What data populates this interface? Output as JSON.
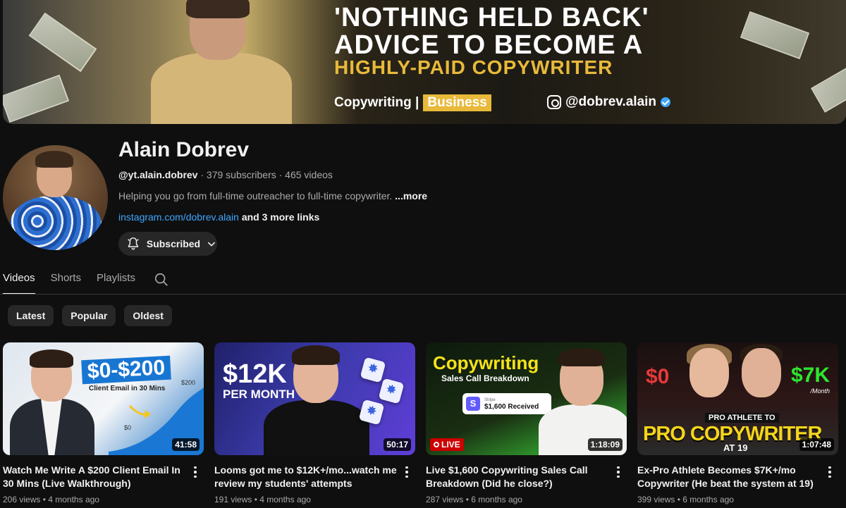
{
  "banner": {
    "line1": "'NOTHING HELD BACK'",
    "line2": "ADVICE TO BECOME A",
    "line3": "HIGHLY-PAID COPYWRITER",
    "tag_left": "Copywriting |",
    "tag_right": "Business",
    "instagram": "@dobrev.alain"
  },
  "channel": {
    "name": "Alain Dobrev",
    "handle": "@yt.alain.dobrev",
    "stats": "· 379 subscribers · 465 videos",
    "description": "Helping you go from full-time outreacher to full-time copywriter.",
    "more": "...more",
    "link": "instagram.com/dobrev.alain",
    "more_links": "and 3 more links",
    "subscribe_label": "Subscribed"
  },
  "tabs": [
    "Videos",
    "Shorts",
    "Playlists"
  ],
  "chips": [
    "Latest",
    "Popular",
    "Oldest"
  ],
  "videos": [
    {
      "title": "Watch Me Write A $200 Client Email In 30 Mins (Live Walkthrough)",
      "views": "206 views",
      "age": "4 months ago",
      "duration": "41:58",
      "thumb_text": {
        "big": "$0-$200",
        "sub": "Client Email in 30 Mins",
        "top": "$200",
        "bottom": "$0"
      }
    },
    {
      "title": "Looms got me to $12K+/mo...watch me review my students' attempts",
      "views": "191 views",
      "age": "4 months ago",
      "duration": "50:17",
      "thumb_text": {
        "big": "$12K",
        "sub": "PER MONTH"
      }
    },
    {
      "title": "Live $1,600 Copywriting Sales Call Breakdown (Did he close?)",
      "views": "287 views",
      "age": "6 months ago",
      "duration": "1:18:09",
      "live": "LIVE",
      "thumb_text": {
        "big": "Copywriting",
        "sub": "Sales Call Breakdown",
        "brand": "Stripe",
        "amount": "$1,600 Received"
      }
    },
    {
      "title": "Ex-Pro Athlete Becomes $7K+/mo Copywriter (He beat the system at 19)",
      "views": "399 views",
      "age": "6 months ago",
      "duration": "1:07:48",
      "thumb_text": {
        "left": "$0",
        "right": "$7K",
        "right_sub": "/Month",
        "tag1": "PRO ATHLETE TO",
        "tag2": "PRO COPYWRITER",
        "tag3": "AT 19"
      }
    }
  ],
  "colors": {
    "background": "#0f0f0f",
    "link": "#3ea6ff",
    "chip": "#272727",
    "muted": "#aaaaaa"
  }
}
